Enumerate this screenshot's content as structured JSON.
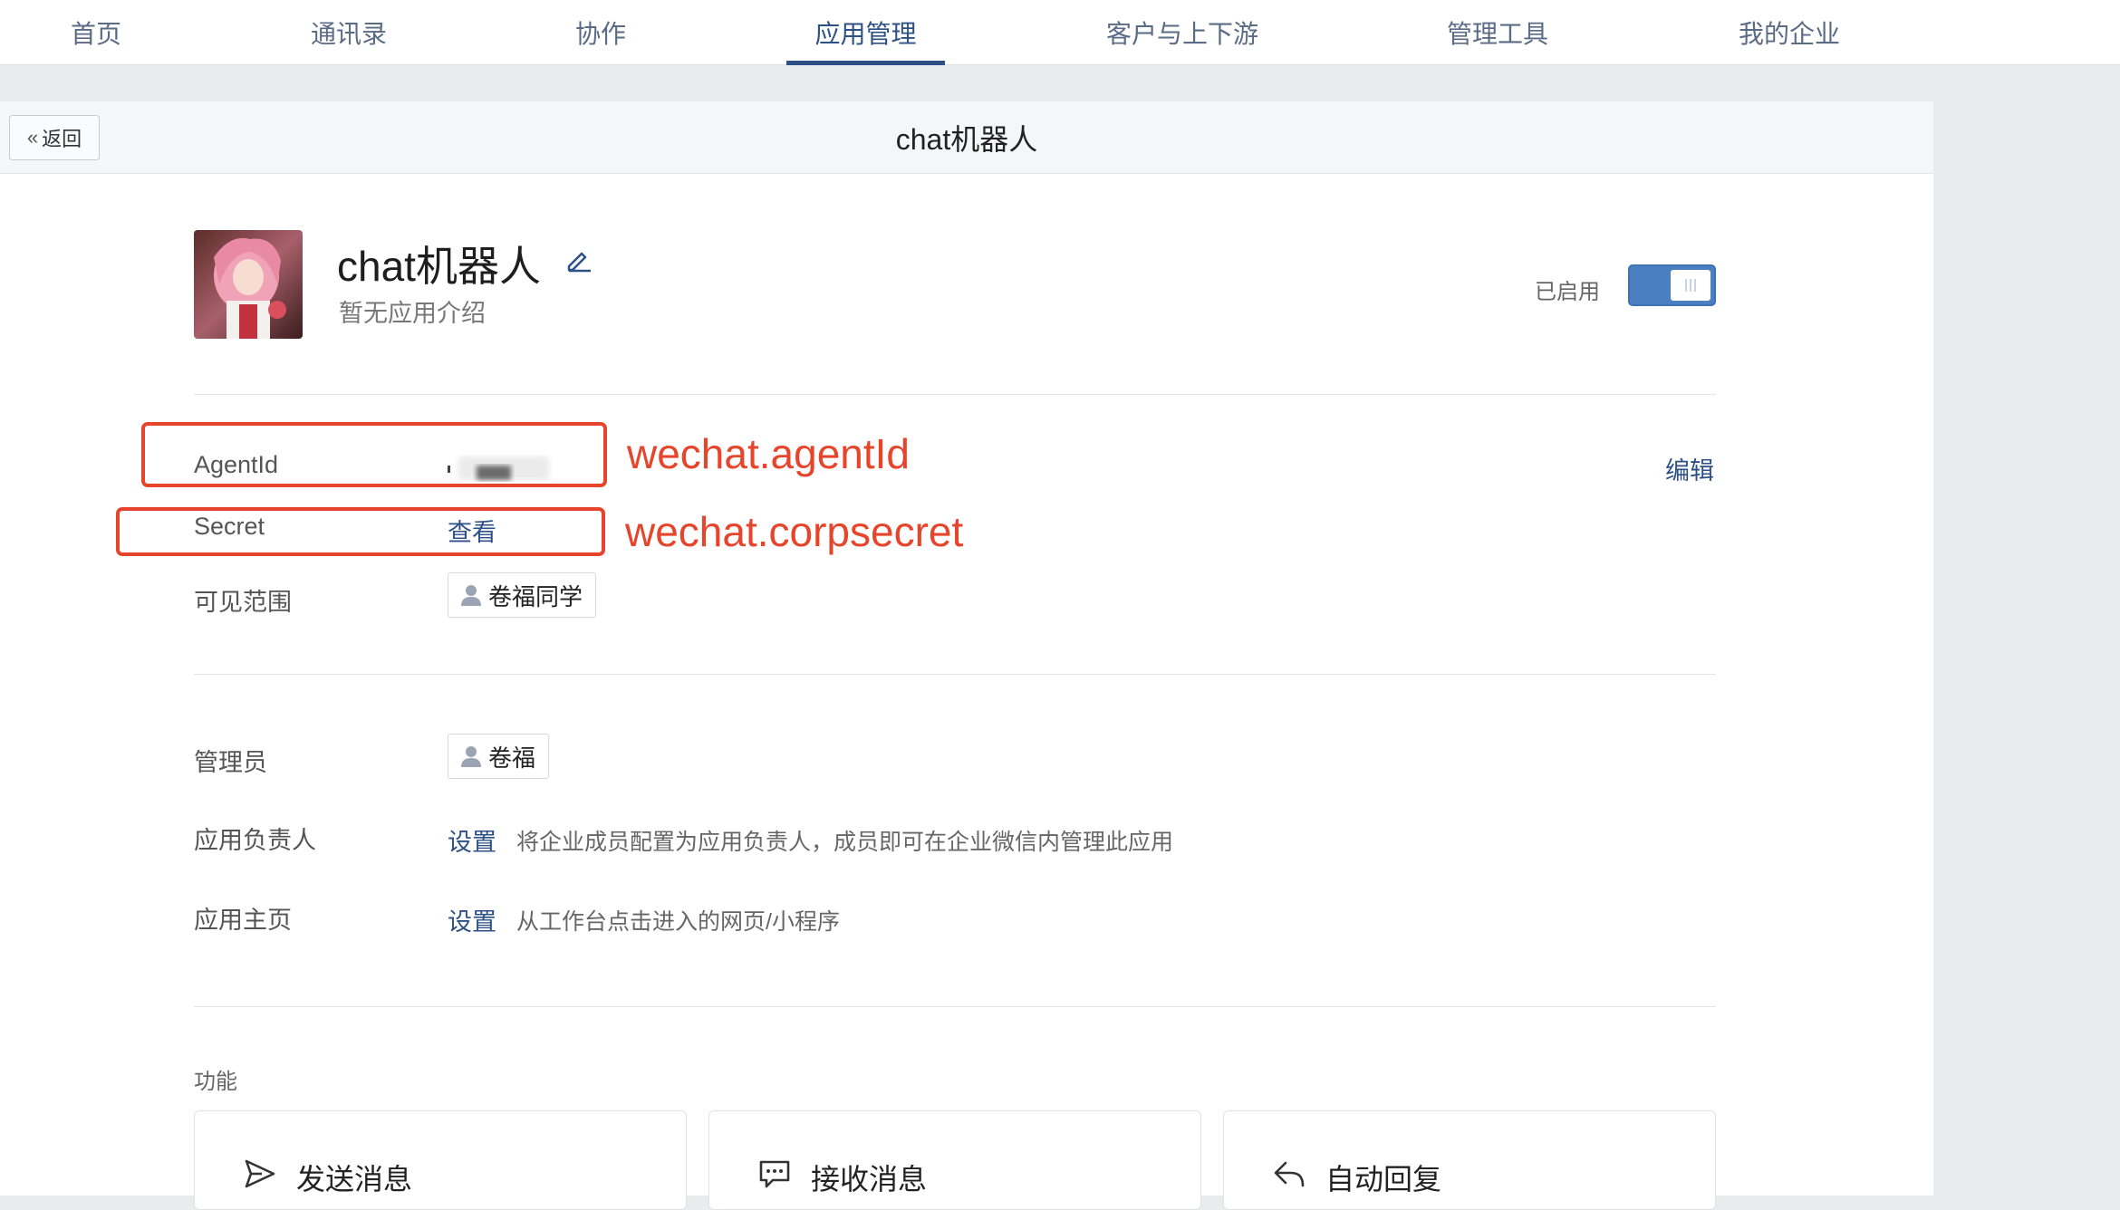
{
  "nav": {
    "items": [
      {
        "label": "首页"
      },
      {
        "label": "通讯录"
      },
      {
        "label": "协作"
      },
      {
        "label": "应用管理",
        "active": true
      },
      {
        "label": "客户与上下游"
      },
      {
        "label": "管理工具"
      },
      {
        "label": "我的企业"
      }
    ]
  },
  "header": {
    "back_label": "返回",
    "title": "chat机器人"
  },
  "app": {
    "name": "chat机器人",
    "description": "暂无应用介绍",
    "status_label": "已启用",
    "enabled": true
  },
  "info": {
    "agentid_label": "AgentId",
    "edit_label": "编辑",
    "secret_label": "Secret",
    "secret_link": "查看",
    "visibility_label": "可见范围",
    "visibility_tag": "卷福同学"
  },
  "annotations": {
    "agentid_note": "wechat.agentId",
    "secret_note": "wechat.corpsecret"
  },
  "admin": {
    "admin_label": "管理员",
    "admin_tag": "卷福",
    "owner_label": "应用负责人",
    "owner_link": "设置",
    "owner_hint": "将企业成员配置为应用负责人，成员即可在企业微信内管理此应用",
    "homepage_label": "应用主页",
    "homepage_link": "设置",
    "homepage_hint": "从工作台点击进入的网页/小程序"
  },
  "features": {
    "section_label": "功能",
    "cards": [
      {
        "label": "发送消息",
        "icon": "send-icon"
      },
      {
        "label": "接收消息",
        "icon": "message-icon"
      },
      {
        "label": "自动回复",
        "icon": "reply-icon"
      }
    ]
  },
  "colors": {
    "nav_active": "#2d5186",
    "link": "#2d5186",
    "toggle_on": "#4a7fc2",
    "annotation": "#e6452b"
  }
}
